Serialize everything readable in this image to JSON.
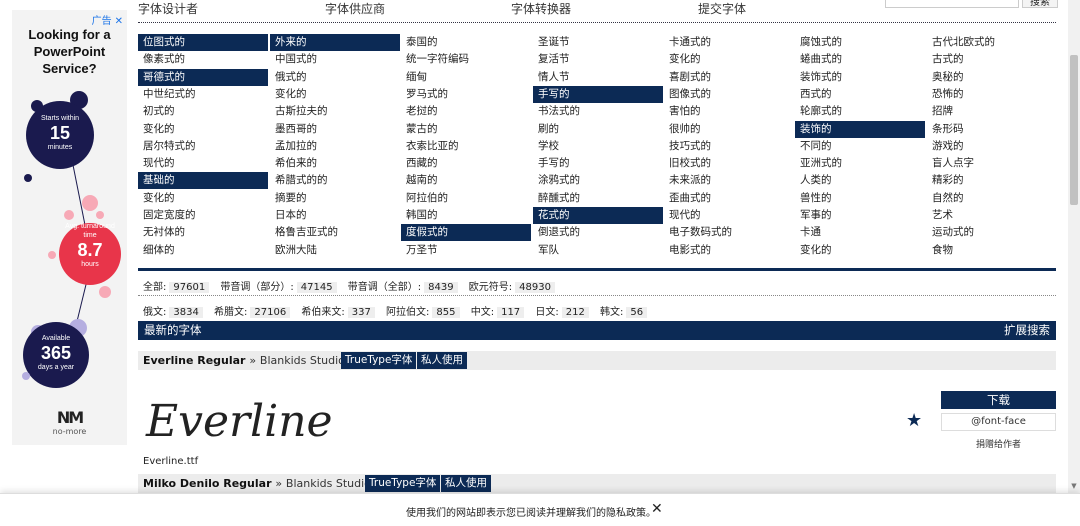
{
  "ad": {
    "tag": "广告",
    "close": "✕",
    "headline": [
      "Looking for a",
      "PowerPoint",
      "Service?"
    ],
    "stats": [
      {
        "top": "Starts within",
        "value": "15",
        "unit": "minutes"
      },
      {
        "top": "Avg. turnaround time",
        "value": "8.7",
        "unit": "hours"
      },
      {
        "top": "Available",
        "value": "365",
        "unit": "days a year"
      }
    ],
    "logo_mark": "NM",
    "logo_text": "no-more",
    "colors": {
      "navy": "#1a1a4e",
      "red": "#e8354a",
      "lavender": "#b5aee0",
      "pink": "#f7a9b6"
    }
  },
  "nav": {
    "items": [
      "字体设计者",
      "字体供应商",
      "字体转换器",
      "提交字体"
    ],
    "search_button": "搜索"
  },
  "categories": [
    [
      {
        "t": "位图式的",
        "hl": true
      },
      {
        "t": "像素式的"
      },
      {
        "t": "哥德式的",
        "hl": true
      },
      {
        "t": "中世纪式的"
      },
      {
        "t": "初式的"
      },
      {
        "t": "变化的"
      },
      {
        "t": "居尔特式的"
      },
      {
        "t": "现代的"
      },
      {
        "t": "基础的",
        "hl": true
      },
      {
        "t": "变化的"
      },
      {
        "t": "固定宽度的"
      },
      {
        "t": "无衬体的"
      },
      {
        "t": "细体的"
      }
    ],
    [
      {
        "t": "外来的",
        "hl": true
      },
      {
        "t": "中国式的"
      },
      {
        "t": "俄式的"
      },
      {
        "t": "变化的"
      },
      {
        "t": "古斯拉夫的"
      },
      {
        "t": "墨西哥的"
      },
      {
        "t": "孟加拉的"
      },
      {
        "t": "希伯来的"
      },
      {
        "t": "希腊式的的"
      },
      {
        "t": "摘要的"
      },
      {
        "t": "日本的"
      },
      {
        "t": "格鲁吉亚式的"
      },
      {
        "t": "欧洲大陆"
      }
    ],
    [
      {
        "t": "泰国的"
      },
      {
        "t": "统一字符编码"
      },
      {
        "t": "缅甸"
      },
      {
        "t": "罗马式的"
      },
      {
        "t": "老挝的"
      },
      {
        "t": "蒙古的"
      },
      {
        "t": "衣索比亚的"
      },
      {
        "t": "西藏的"
      },
      {
        "t": "越南的"
      },
      {
        "t": "阿拉伯的"
      },
      {
        "t": "韩国的"
      },
      {
        "t": "度假式的",
        "hl": true
      },
      {
        "t": "万圣节"
      }
    ],
    [
      {
        "t": "圣诞节"
      },
      {
        "t": "复活节"
      },
      {
        "t": "情人节"
      },
      {
        "t": "手写的",
        "hl": true
      },
      {
        "t": "书法式的"
      },
      {
        "t": "刷的"
      },
      {
        "t": "学校"
      },
      {
        "t": "手写的"
      },
      {
        "t": "涂鸦式的"
      },
      {
        "t": "醉醺式的"
      },
      {
        "t": "花式的",
        "hl": true
      },
      {
        "t": "倒退式的"
      },
      {
        "t": "军队"
      }
    ],
    [
      {
        "t": "卡通式的"
      },
      {
        "t": "变化的"
      },
      {
        "t": "喜剧式的"
      },
      {
        "t": "图像式的"
      },
      {
        "t": "害怕的"
      },
      {
        "t": "很帅的"
      },
      {
        "t": "技巧式的"
      },
      {
        "t": "旧校式的"
      },
      {
        "t": "未来派的"
      },
      {
        "t": "歪曲式的"
      },
      {
        "t": "现代的"
      },
      {
        "t": "电子数码式的"
      },
      {
        "t": "电影式的"
      }
    ],
    [
      {
        "t": "腐蚀式的"
      },
      {
        "t": "蜷曲式的"
      },
      {
        "t": "装饰式的"
      },
      {
        "t": "西式的"
      },
      {
        "t": "轮廓式的"
      },
      {
        "t": "装饰的",
        "hl": true
      },
      {
        "t": "不同的"
      },
      {
        "t": "亚洲式的"
      },
      {
        "t": "人类的"
      },
      {
        "t": "兽性的"
      },
      {
        "t": "军事的"
      },
      {
        "t": "卡通"
      },
      {
        "t": "变化的"
      }
    ],
    [
      {
        "t": "古代北欧式的"
      },
      {
        "t": "古式的"
      },
      {
        "t": "奥秘的"
      },
      {
        "t": "恐怖的"
      },
      {
        "t": "招牌"
      },
      {
        "t": "条形码"
      },
      {
        "t": "游戏的"
      },
      {
        "t": "盲人点字"
      },
      {
        "t": "精彩的"
      },
      {
        "t": "自然的"
      },
      {
        "t": "艺术"
      },
      {
        "t": "运动式的"
      },
      {
        "t": "食物"
      }
    ]
  ],
  "counts1": [
    {
      "label": "全部:",
      "value": "97601"
    },
    {
      "label": "带音调（部分）:",
      "value": "47145"
    },
    {
      "label": "带音调（全部）:",
      "value": "8439"
    },
    {
      "label": "欧元符号:",
      "value": "48930"
    }
  ],
  "counts2": [
    {
      "label": "俄文:",
      "value": "3834"
    },
    {
      "label": "希腊文:",
      "value": "27106"
    },
    {
      "label": "希伯来文:",
      "value": "337"
    },
    {
      "label": "阿拉伯文:",
      "value": "855"
    },
    {
      "label": "中文:",
      "value": "117"
    },
    {
      "label": "日文:",
      "value": "212"
    },
    {
      "label": "韩文:",
      "value": "56"
    }
  ],
  "newest": {
    "title": "最新的字体",
    "extended_search": "扩展搜索"
  },
  "fonts": [
    {
      "name": "Everline Regular",
      "sep": "»",
      "foundry": "Blankids Studio",
      "type": "TrueType字体",
      "license": "私人使用",
      "preview": "Everline",
      "file": "Everline.ttf"
    },
    {
      "name": "Milko Denilo Regular",
      "sep": "»",
      "foundry": "Blankids Studio",
      "type": "TrueType字体",
      "license": "私人使用"
    }
  ],
  "actions": {
    "download": "下载",
    "fontface": "@font-face",
    "donate": "捐赠给作者",
    "star": "★"
  },
  "cookie": {
    "message": "使用我们的网站即表示您已阅读并理解我们的隐私政策。",
    "close": "✕"
  }
}
